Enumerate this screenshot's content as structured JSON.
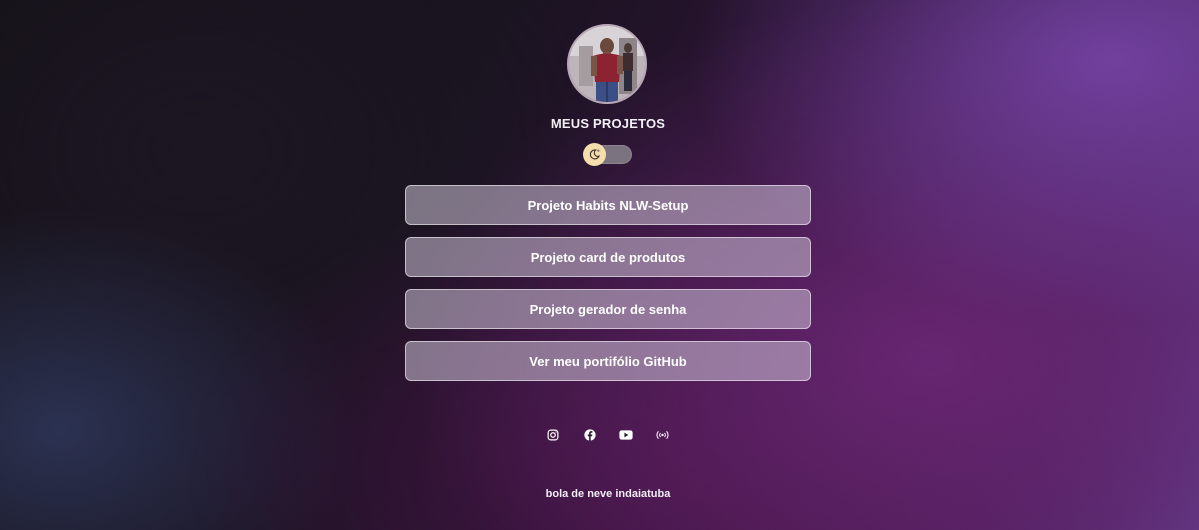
{
  "profile": {
    "title": "MEUS PROJETOS"
  },
  "theme_toggle": {
    "icon": "moon-sun-icon",
    "knob_color": "#f5deac"
  },
  "links": [
    {
      "label": "Projeto Habits NLW-Setup"
    },
    {
      "label": "Projeto card de produtos"
    },
    {
      "label": "Projeto gerador de senha"
    },
    {
      "label": "Ver meu portifólio GitHub"
    }
  ],
  "social": [
    "instagram-icon",
    "facebook-icon",
    "youtube-icon",
    "radio-broadcast-icon"
  ],
  "footer": {
    "text": "bola de neve indaiatuba"
  },
  "colors": {
    "button_bg": "rgba(205,195,215,0.55)",
    "accent_purple": "#5e3a85"
  }
}
